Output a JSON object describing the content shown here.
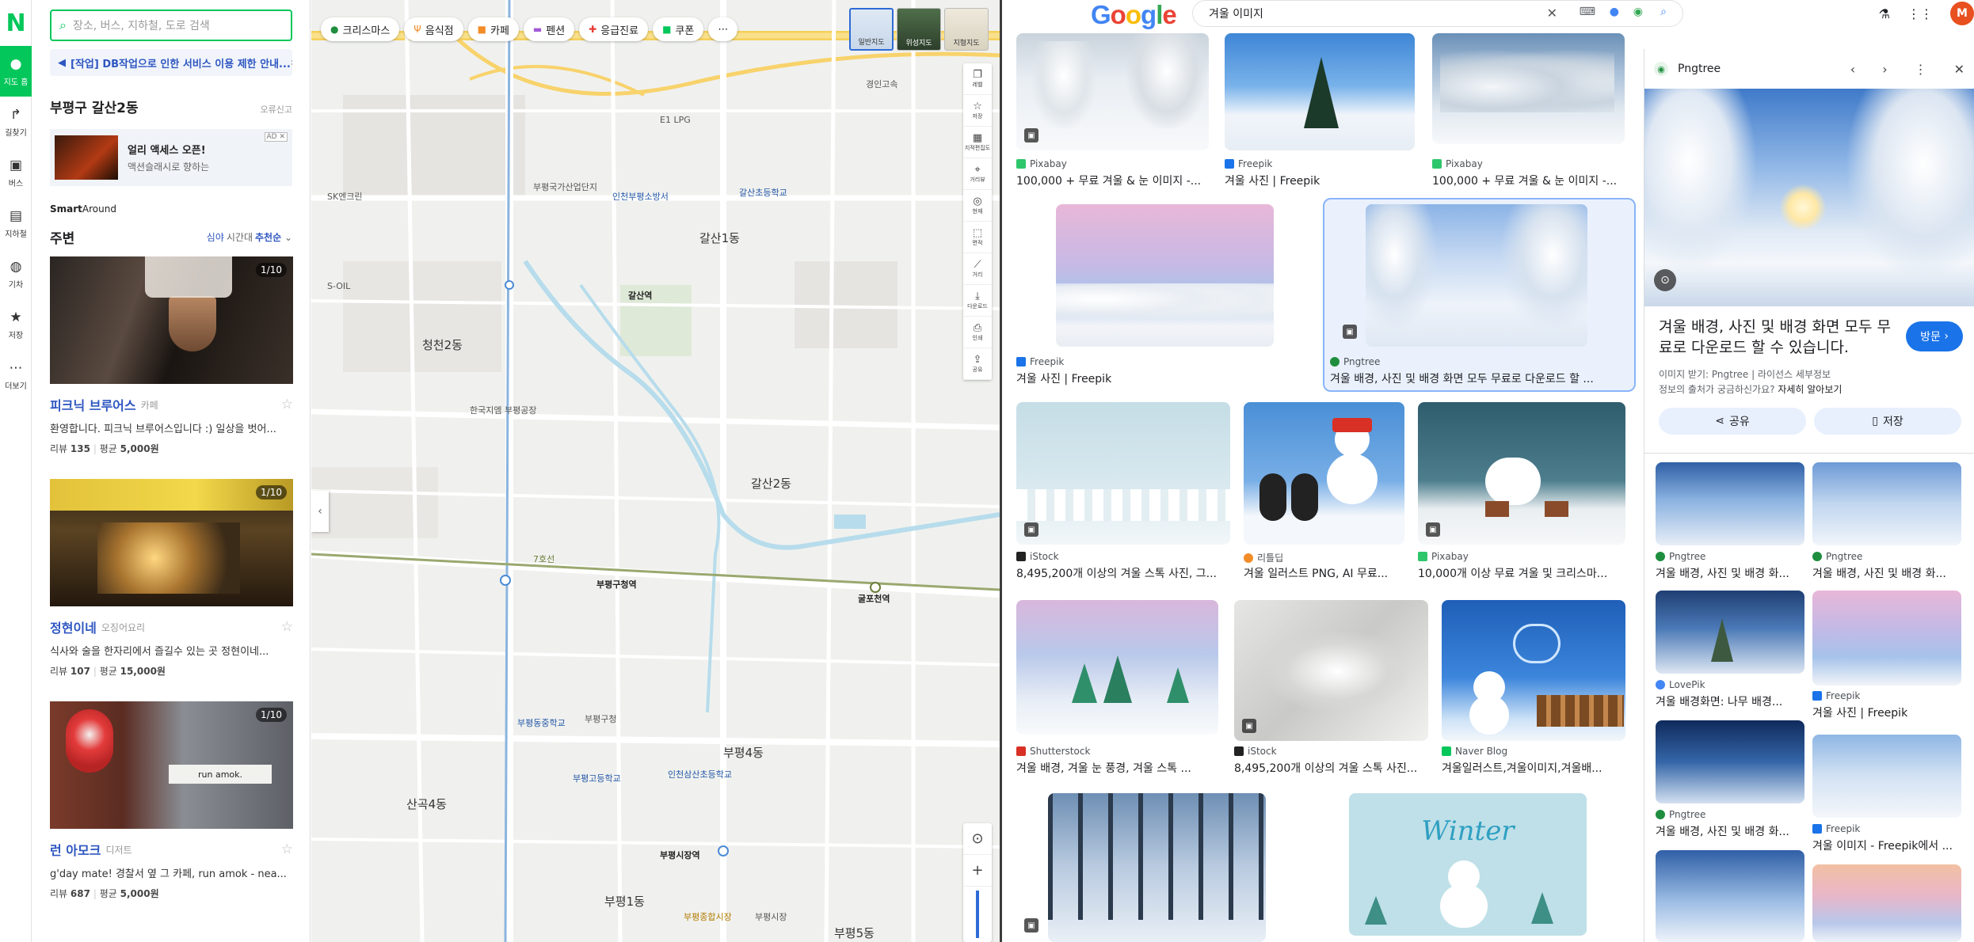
{
  "naver": {
    "rail": [
      {
        "label": "지도 홈"
      },
      {
        "label": "길찾기"
      },
      {
        "label": "버스"
      },
      {
        "label": "지하철"
      },
      {
        "label": "기차"
      },
      {
        "label": "저장"
      },
      {
        "label": "더보기"
      }
    ],
    "search_placeholder": "장소, 버스, 지하철, 도로 검색",
    "notice": "[작업] DB작업으로 인한 서비스 이용 제한 안내...",
    "area_title": "부평구 갈산2동",
    "area_report": "오류신고",
    "ad": {
      "line1": "얼리 액세스 오픈!",
      "line2": "액션슬래시로 향하는",
      "tag": "AD"
    },
    "smart_around": {
      "bold": "Smart",
      "rest": "Around"
    },
    "nearby": {
      "title": "주변",
      "time_prefix": "심야",
      "time_label": "시간대",
      "sort": "추천순"
    },
    "places": [
      {
        "name": "피크닉 브루어스",
        "category": "카페",
        "desc": "환영합니다. 피크닉 브루어스입니다 :) 일상을 벗어...",
        "review_label": "리뷰",
        "reviews": "135",
        "avg_label": "평균",
        "avg": "5,000원",
        "count": "1/10"
      },
      {
        "name": "정현이네",
        "category": "오징어요리",
        "desc": "식사와 술을 한자리에서 즐길수 있는 곳 정현이네...",
        "review_label": "리뷰",
        "reviews": "107",
        "avg_label": "평균",
        "avg": "15,000원",
        "count": "1/10"
      },
      {
        "name": "런 아모크",
        "category": "디저트",
        "desc": "g'day mate! 경찰서 옆 그 카페, run amok - nea...",
        "review_label": "리뷰",
        "reviews": "687",
        "avg_label": "평균",
        "avg": "5,000원",
        "count": "1/10"
      }
    ],
    "chips": [
      {
        "label": "크리스마스",
        "icon": "tree-icon"
      },
      {
        "label": "음식점",
        "icon": "fork-icon"
      },
      {
        "label": "카페",
        "icon": "cup-icon"
      },
      {
        "label": "펜션",
        "icon": "bed-icon"
      },
      {
        "label": "응급진료",
        "icon": "cross-icon"
      },
      {
        "label": "쿠폰",
        "icon": "coupon-icon"
      }
    ],
    "map_types": [
      "일반지도",
      "위성지도",
      "지형지도"
    ],
    "tools": [
      "레벨",
      "저장",
      "지적편집도",
      "거리뷰",
      "현재",
      "면적",
      "거리",
      "다운로드",
      "인쇄",
      "공유"
    ],
    "map_labels": [
      "갈산1동",
      "갈산2동",
      "청천2동",
      "산곡4동",
      "부평4동",
      "부평1동",
      "부평5동",
      "갈산역",
      "부평구청역",
      "굴포천역",
      "부평시장역",
      "부평국가산업단지",
      "부평구청",
      "인천부평소방서",
      "부평시장",
      "한국지엠 부평공장",
      "갈산초등학교",
      "부평고등학교",
      "인천삼산초등학교",
      "부평동중학교",
      "부평종합시장",
      "E1 LPG",
      "S-OIL",
      "SK엔크린",
      "7호선",
      "경인고속"
    ]
  },
  "google": {
    "query": "겨울 이미지",
    "avatar": "M",
    "results": [
      {
        "source": "Pixabay",
        "title": "100,000 + 무료 겨울 & 눈 이미지 -..."
      },
      {
        "source": "Freepik",
        "title": "겨울 사진 | Freepik"
      },
      {
        "source": "Pixabay",
        "title": "100,000 + 무료 겨울 & 눈 이미지 -..."
      },
      {
        "source": "Freepik",
        "title": "겨울 사진 | Freepik"
      },
      {
        "source": "Pngtree",
        "title": "겨울 배경, 사진 및 배경 화면 모두 무료로 다운로드 할 ..."
      },
      {
        "source": "iStock",
        "title": "8,495,200개 이상의 겨울 스톡 사진, 그..."
      },
      {
        "source": "리틀딥",
        "title": "겨울 일러스트 PNG, AI 무료..."
      },
      {
        "source": "Pixabay",
        "title": "10,000개 이상 무료 겨울 및 크리스마..."
      },
      {
        "source": "Shutterstock",
        "title": "겨울 배경, 겨울 눈 풍경, 겨울 스톡 ..."
      },
      {
        "source": "iStock",
        "title": "8,495,200개 이상의 겨울 스톡 사진..."
      },
      {
        "source": "Naver Blog",
        "title": "겨울일러스트,겨울이미지,겨울배..."
      }
    ],
    "panel": {
      "source": "Pngtree",
      "title": "겨울 배경, 사진 및 배경 화면 모두 무료로 다운로드 할 수 있습니다.",
      "visit": "방문",
      "meta_line1": "이미지 받기: Pngtree | 라이선스 세부정보",
      "meta_line2a": "정보의 출처가 궁금하신가요?",
      "meta_line2b": "자세히 알아보기",
      "share": "공유",
      "save": "저장",
      "related": [
        {
          "source": "Pngtree",
          "title": "겨울 배경, 사진 및 배경 화..."
        },
        {
          "source": "Pngtree",
          "title": "겨울 배경, 사진 및 배경 화..."
        },
        {
          "source": "LovePik",
          "title": "겨울 배경화면: 나무 배경..."
        },
        {
          "source": "Freepik",
          "title": "겨울 사진 | Freepik"
        },
        {
          "source": "Pngtree",
          "title": "겨울 배경, 사진 및 배경 화..."
        },
        {
          "source": "Freepik",
          "title": "겨울 이미지 - Freepik에서 ..."
        }
      ]
    },
    "winter_art_text": "Winter"
  }
}
